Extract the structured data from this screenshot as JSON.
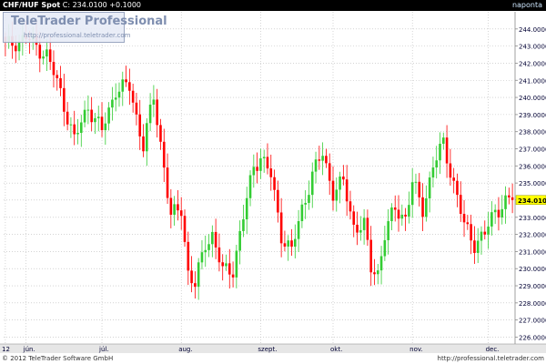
{
  "header": {
    "instrument": "CHF/HUF Spot",
    "close_label": "C: 234.0100",
    "change_label": "+0.1000",
    "period": "naponta"
  },
  "watermark": {
    "brand": "TeleTrader Professional",
    "url": "http://professional.teletrader.com"
  },
  "footer": {
    "copyright": "© 2012 TeleTrader Software GmbH",
    "url": "http://professional.teletrader.com"
  },
  "colors": {
    "background": "#ffffff",
    "up_candle": "#33cc33",
    "down_candle": "#ff0000",
    "wick": "#444444",
    "grid": "#bbbbbb",
    "axis_text": "#000033",
    "price_tag_bg": "#ffff00",
    "x_axis_band": "#e6e6e6"
  },
  "chart_data": {
    "type": "candlestick",
    "title": "CHF/HUF Spot",
    "ylim": [
      225.6,
      245.0
    ],
    "y_ticks": [
      "226.0000",
      "227.0000",
      "228.0000",
      "229.0000",
      "230.0000",
      "231.0000",
      "232.0000",
      "233.0000",
      "234.0100",
      "235.0000",
      "236.0000",
      "237.0000",
      "238.0000",
      "239.0000",
      "240.0000",
      "241.0000",
      "242.0000",
      "243.0000",
      "244.0000"
    ],
    "last_price": 234.01,
    "last_price_label": "234.0100",
    "month_labels": [
      {
        "label": "12",
        "index": 0
      },
      {
        "label": "jún.",
        "index": 6
      },
      {
        "label": "júl.",
        "index": 28
      },
      {
        "label": "aug.",
        "index": 51
      },
      {
        "label": "szept.",
        "index": 74
      },
      {
        "label": "okt.",
        "index": 95
      },
      {
        "label": "nov.",
        "index": 118
      },
      {
        "label": "dec.",
        "index": 140
      }
    ],
    "candle_count": 148,
    "keypoints": [
      [
        0,
        243.0
      ],
      [
        6,
        243.5
      ],
      [
        12,
        242.5
      ],
      [
        16,
        240.3
      ],
      [
        20,
        237.5
      ],
      [
        24,
        239.5
      ],
      [
        28,
        238.0
      ],
      [
        32,
        240.5
      ],
      [
        36,
        240.6
      ],
      [
        40,
        237.2
      ],
      [
        43,
        240.0
      ],
      [
        46,
        236.0
      ],
      [
        48,
        233.0
      ],
      [
        51,
        233.5
      ],
      [
        53,
        229.8
      ],
      [
        55,
        229.0
      ],
      [
        58,
        231.5
      ],
      [
        60,
        232.0
      ],
      [
        63,
        229.8
      ],
      [
        66,
        230.0
      ],
      [
        69,
        233.0
      ],
      [
        72,
        236.0
      ],
      [
        74,
        236.6
      ],
      [
        77,
        235.4
      ],
      [
        80,
        232.0
      ],
      [
        83,
        231.0
      ],
      [
        86,
        233.5
      ],
      [
        89,
        235.5
      ],
      [
        92,
        236.7
      ],
      [
        95,
        234.5
      ],
      [
        98,
        235.0
      ],
      [
        101,
        232.5
      ],
      [
        104,
        232.5
      ],
      [
        106,
        230.0
      ],
      [
        108,
        229.8
      ],
      [
        110,
        232.0
      ],
      [
        113,
        233.5
      ],
      [
        116,
        233.0
      ],
      [
        118,
        235.0
      ],
      [
        121,
        233.5
      ],
      [
        124,
        236.0
      ],
      [
        127,
        237.3
      ],
      [
        130,
        235.0
      ],
      [
        133,
        232.5
      ],
      [
        136,
        231.5
      ],
      [
        139,
        232.0
      ],
      [
        142,
        233.4
      ],
      [
        145,
        233.9
      ],
      [
        147,
        234.01
      ]
    ],
    "annotations": [
      "234.0100"
    ]
  }
}
